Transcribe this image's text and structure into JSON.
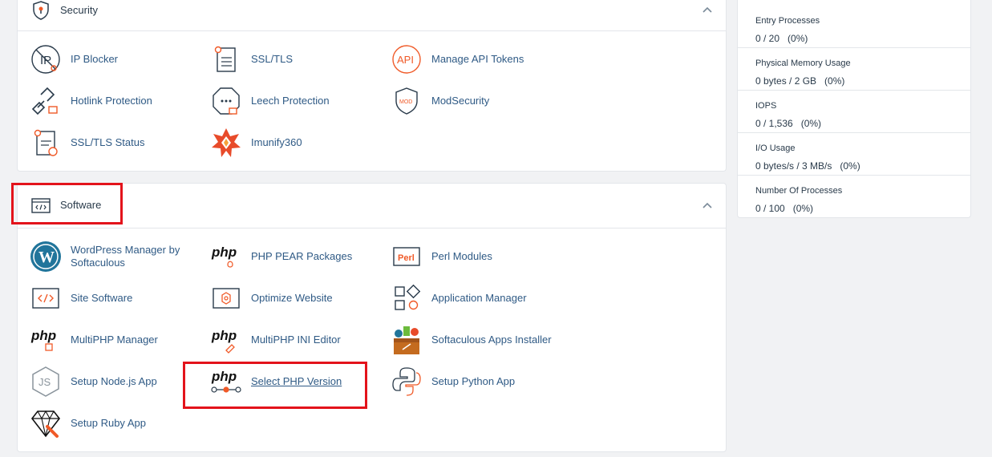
{
  "security": {
    "title": "Security",
    "items": [
      {
        "label": "IP Blocker",
        "icon": "ip-blocker-icon"
      },
      {
        "label": "SSL/TLS",
        "icon": "ssl-tls-icon"
      },
      {
        "label": "Manage API Tokens",
        "icon": "api-tokens-icon"
      },
      {
        "label": "Hotlink Protection",
        "icon": "hotlink-protection-icon"
      },
      {
        "label": "Leech Protection",
        "icon": "leech-protection-icon"
      },
      {
        "label": "ModSecurity",
        "icon": "modsecurity-icon"
      },
      {
        "label": "SSL/TLS Status",
        "icon": "ssl-tls-status-icon"
      },
      {
        "label": "Imunify360",
        "icon": "imunify360-icon"
      }
    ]
  },
  "software": {
    "title": "Software",
    "items": [
      {
        "label": "WordPress Manager by Softaculous",
        "icon": "wordpress-icon"
      },
      {
        "label": "PHP PEAR Packages",
        "icon": "php-pear-icon"
      },
      {
        "label": "Perl Modules",
        "icon": "perl-icon"
      },
      {
        "label": "Site Software",
        "icon": "site-software-icon"
      },
      {
        "label": "Optimize Website",
        "icon": "optimize-website-icon"
      },
      {
        "label": "Application Manager",
        "icon": "application-manager-icon"
      },
      {
        "label": "MultiPHP Manager",
        "icon": "multiphp-manager-icon"
      },
      {
        "label": "MultiPHP INI Editor",
        "icon": "multiphp-ini-editor-icon"
      },
      {
        "label": "Softaculous Apps Installer",
        "icon": "softaculous-icon"
      },
      {
        "label": "Setup Node.js App",
        "icon": "nodejs-icon"
      },
      {
        "label": "Select PHP Version",
        "icon": "select-php-version-icon"
      },
      {
        "label": "Setup Python App",
        "icon": "python-icon"
      },
      {
        "label": "Setup Ruby App",
        "icon": "ruby-icon"
      }
    ]
  },
  "stats": [
    {
      "label": "Entry Processes",
      "value": "0 / 20   (0%)"
    },
    {
      "label": "Physical Memory Usage",
      "value": "0 bytes / 2 GB   (0%)"
    },
    {
      "label": "IOPS",
      "value": "0 / 1,536   (0%)"
    },
    {
      "label": "I/O Usage",
      "value": "0 bytes/s / 3 MB/s   (0%)"
    },
    {
      "label": "Number Of Processes",
      "value": "0 / 100   (0%)"
    }
  ],
  "colors": {
    "accent": "#f05a28",
    "link": "#2f5a85",
    "highlight": "#e3131b",
    "text": "#293a4a"
  }
}
